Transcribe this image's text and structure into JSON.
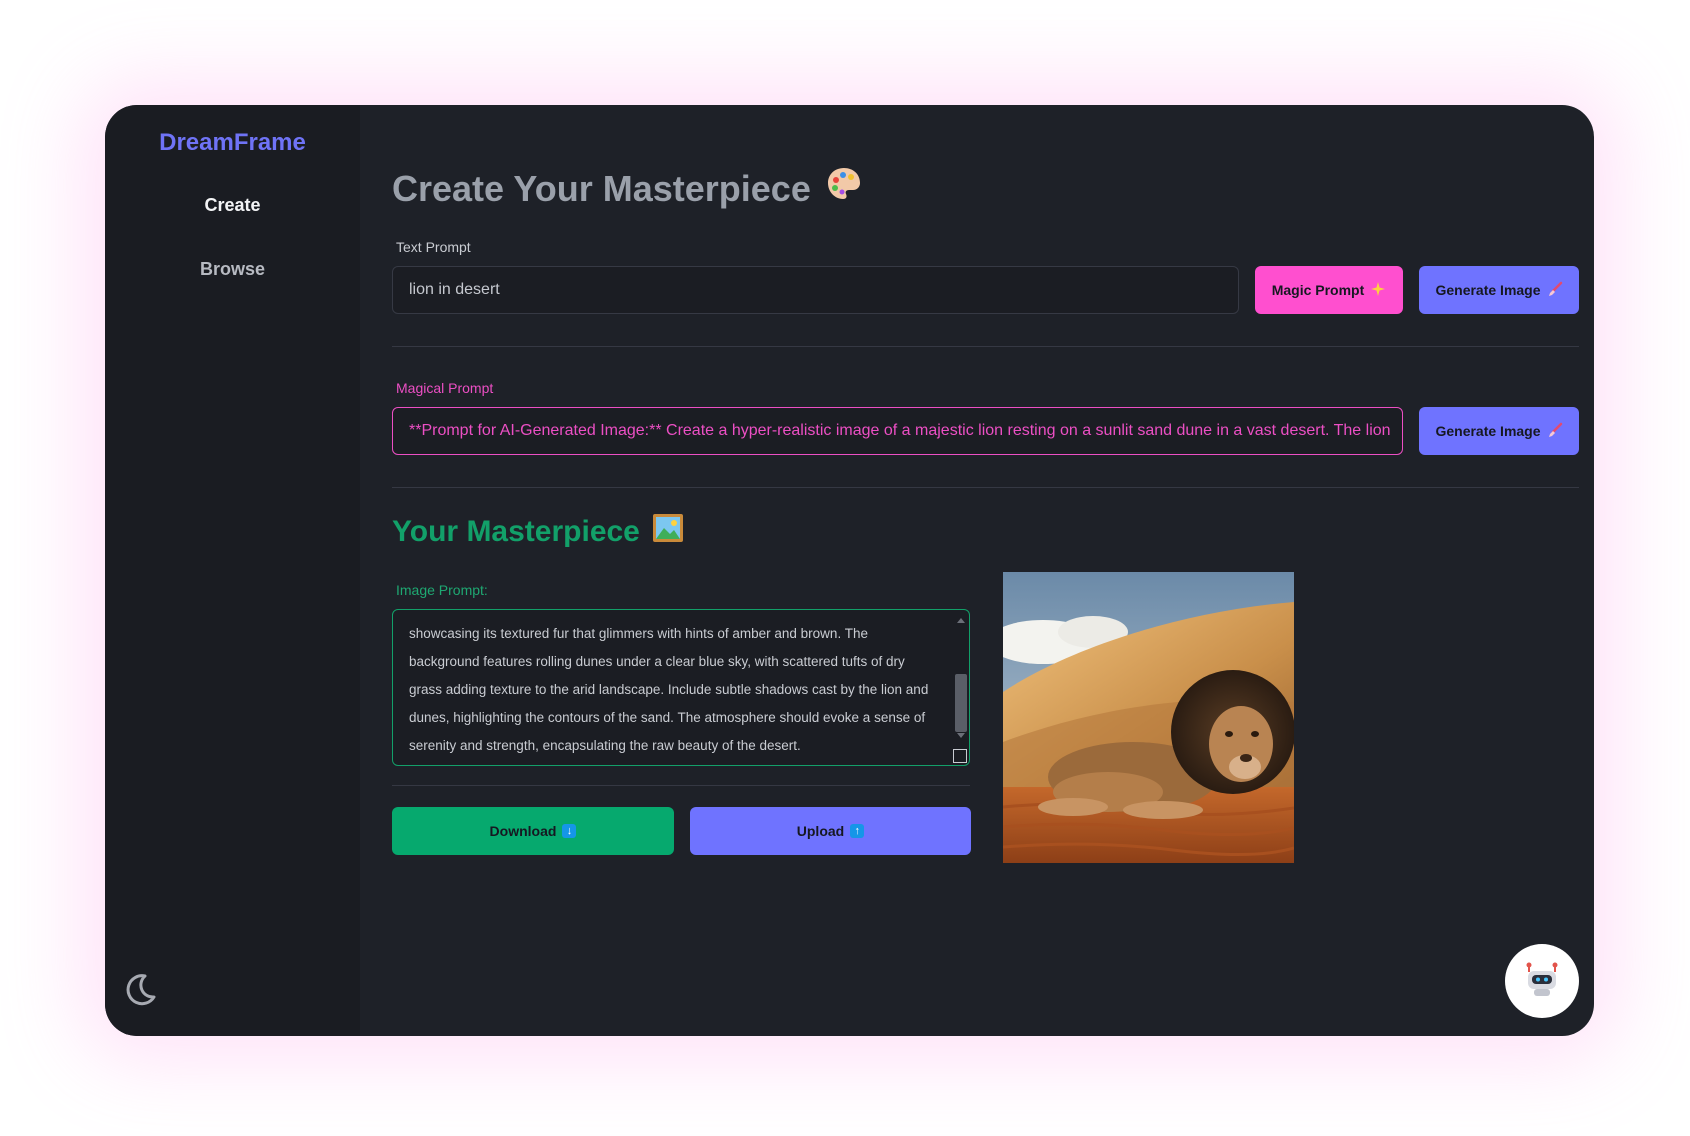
{
  "app": {
    "brand": "DreamFrame"
  },
  "sidebar": {
    "items": [
      {
        "label": "Create",
        "active": true
      },
      {
        "label": "Browse",
        "active": false
      }
    ],
    "theme_icon": "moon-icon"
  },
  "main": {
    "title": "Create Your Masterpiece",
    "title_icon": "palette-emoji-icon",
    "text_prompt": {
      "label": "Text Prompt",
      "value": "lion in desert"
    },
    "buttons": {
      "magic_prompt": "Magic Prompt",
      "generate_image": "Generate Image",
      "download": "Download",
      "upload": "Upload"
    },
    "magical_prompt": {
      "label": "Magical Prompt",
      "value": "**Prompt for AI-Generated Image:** Create a hyper-realistic image of a majestic lion resting on a sunlit sand dune in a vast desert. The lion"
    },
    "result": {
      "title": "Your Masterpiece",
      "title_icon": "framed-picture-emoji-icon",
      "image_prompt_label": "Image Prompt:",
      "image_prompt_text": "showcasing its textured fur that glimmers with hints of amber and brown. The background features rolling dunes under a clear blue sky, with scattered tufts of dry grass adding texture to the arid landscape. Include subtle shadows cast by the lion and dunes, highlighting the contours of the sand. The atmosphere should evoke a sense of serenity and strength, encapsulating the raw beauty of the desert.",
      "image_subject": "lion-in-desert-image"
    },
    "chat_icon": "robot-icon"
  },
  "colors": {
    "brand": "#6f73f6",
    "magic": "#ff4fcf",
    "generate": "#6f73ff",
    "success": "#06a96e",
    "background": "#1e2128",
    "sidebar": "#1a1c22"
  }
}
